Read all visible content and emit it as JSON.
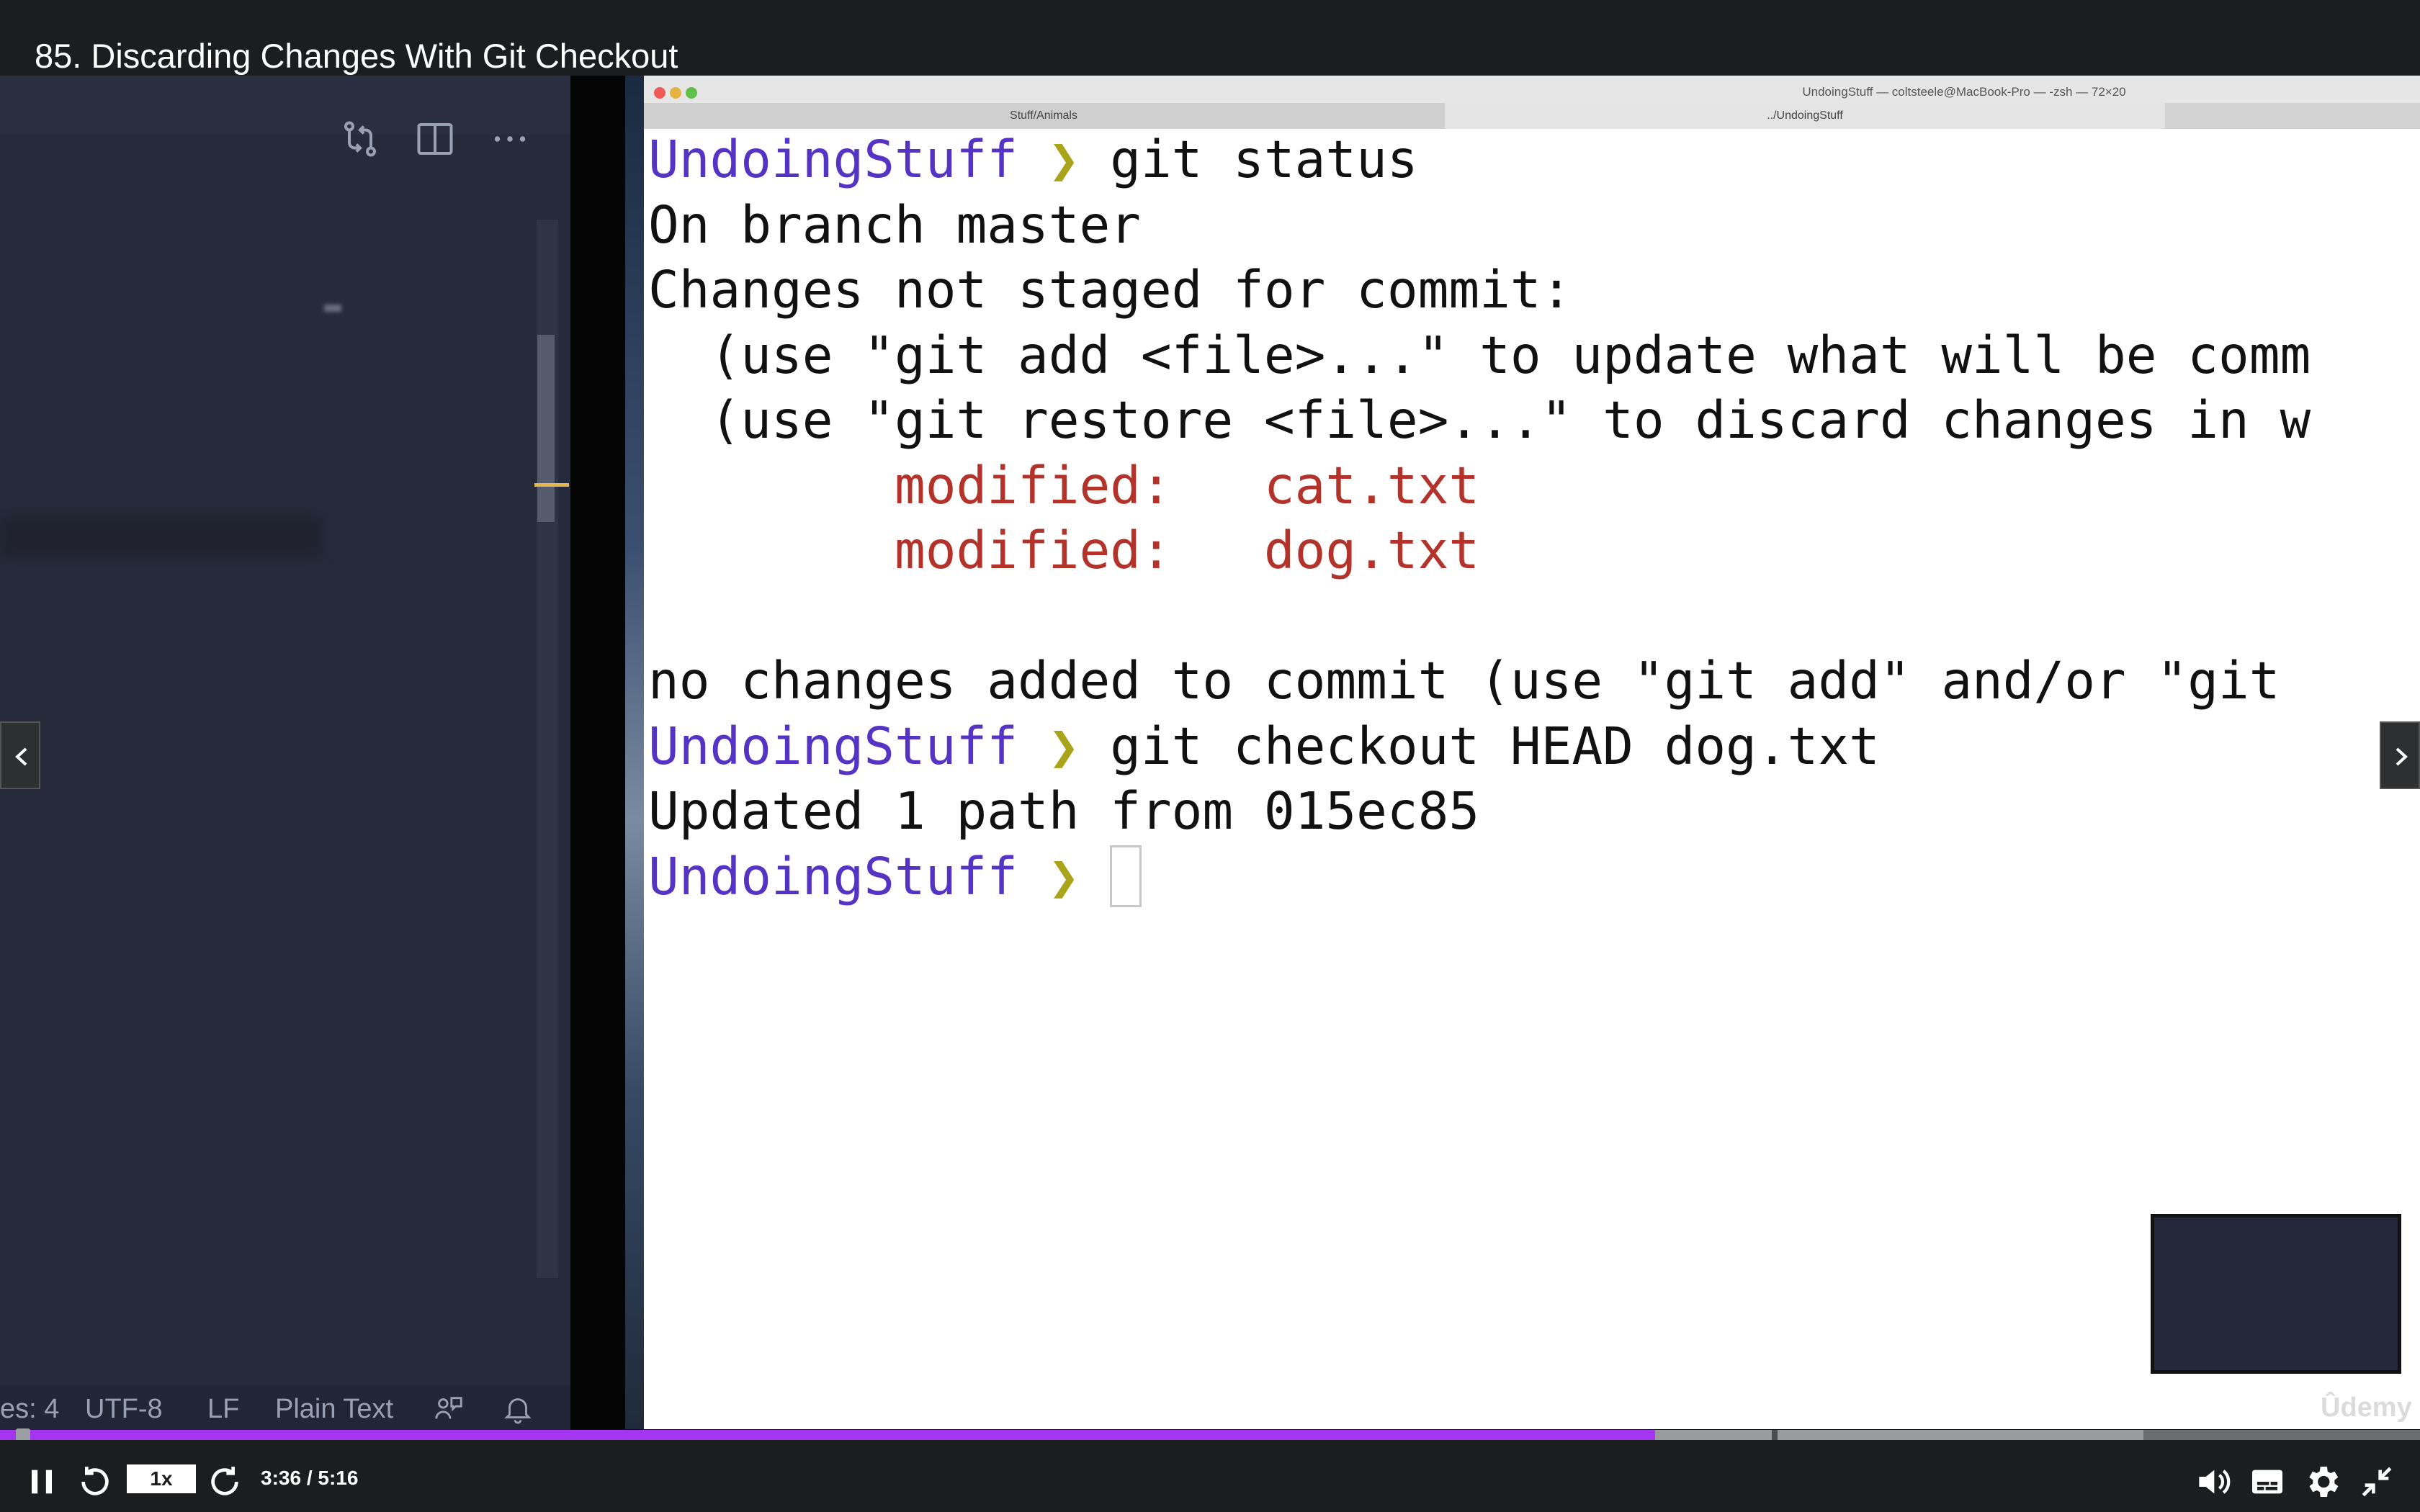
{
  "player": {
    "lecture_title": "85. Discarding Changes With Git Checkout",
    "current_time": "3:36",
    "duration": "5:16",
    "time_display": "3:36 / 5:16",
    "speed": "1x",
    "progress_fraction": 0.684,
    "watermark": "Ûdemy",
    "accent_color": "#a435f0"
  },
  "vscode": {
    "status_items": [
      "es: 4",
      "UTF-8",
      "LF",
      "Plain Text"
    ],
    "status_icons": [
      "feedback-icon",
      "bell-icon"
    ],
    "toolbar_icons": [
      "compare-changes-icon",
      "split-editor-icon",
      "more-actions-icon"
    ]
  },
  "terminal": {
    "title": "UndoingStuff — coltsteele@MacBook-Pro — -zsh — 72×20",
    "tabs": [
      "Stuff/Animals",
      "../UndoingStuff"
    ],
    "lines": [
      {
        "prompt": "UndoingStuff",
        "arrow": "❯",
        "text": " git status"
      },
      {
        "text": "On branch master"
      },
      {
        "text": "Changes not staged for commit:"
      },
      {
        "text": "  (use \"git add <file>...\" to update what will be comm"
      },
      {
        "text": "  (use \"git restore <file>...\" to discard changes in w"
      },
      {
        "red": "        modified:   cat.txt"
      },
      {
        "red": "        modified:   dog.txt"
      },
      {
        "text": ""
      },
      {
        "text": "no changes added to commit (use \"git add\" and/or \"git "
      },
      {
        "prompt": "UndoingStuff",
        "arrow": "❯",
        "text": " git checkout HEAD dog.txt"
      },
      {
        "text": "Updated 1 path from 015ec85"
      },
      {
        "prompt": "UndoingStuff",
        "arrow": "❯",
        "text": " ",
        "cursor": true
      }
    ],
    "prompt_color": "#5433c5",
    "arrow_color": "#a9a41a",
    "modified_color": "#b3332a"
  },
  "controls": {
    "icons": [
      "pause-icon",
      "rewind-5-icon",
      "forward-5-icon",
      "volume-icon",
      "captions-icon",
      "settings-gear-icon",
      "exit-fullscreen-icon"
    ]
  }
}
